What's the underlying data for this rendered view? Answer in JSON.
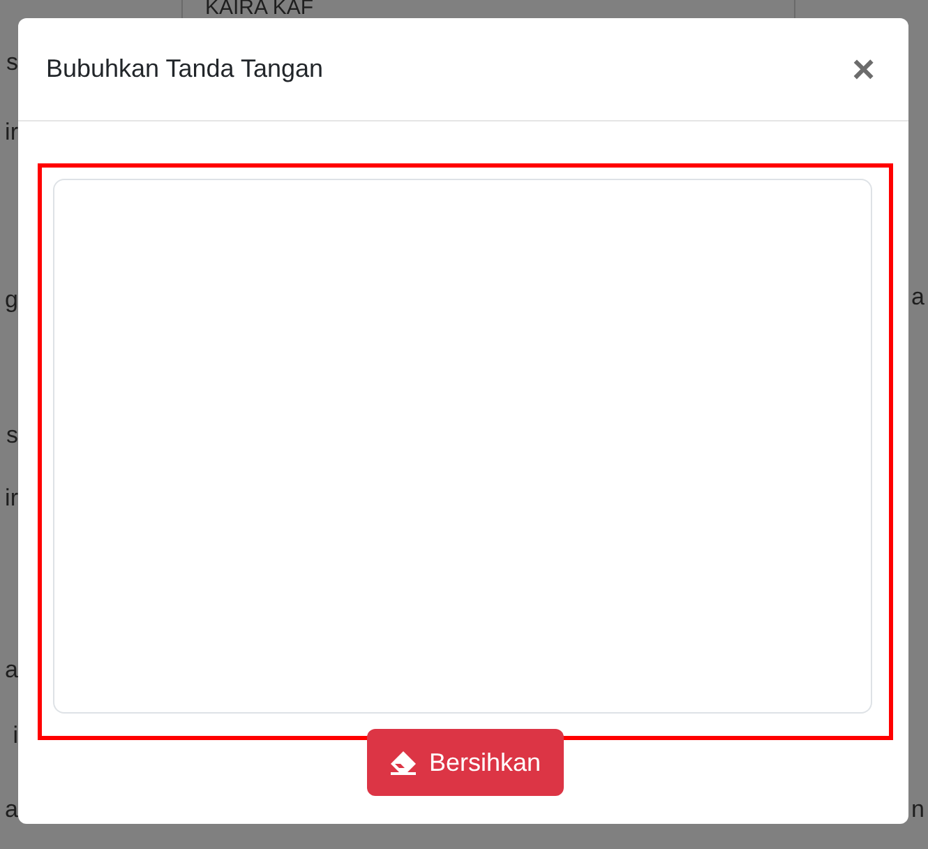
{
  "background": {
    "header_cell": "KAIRA KAF",
    "left_fragments": [
      "s",
      "ir",
      "g",
      "s",
      "ir",
      "a",
      "i",
      "a"
    ],
    "right_fragments": [
      "a",
      "n"
    ]
  },
  "modal": {
    "title": "Bubuhkan Tanda Tangan",
    "close": "×",
    "signature_area": {
      "highlighted": true
    },
    "clear_button": "Bersihkan"
  }
}
